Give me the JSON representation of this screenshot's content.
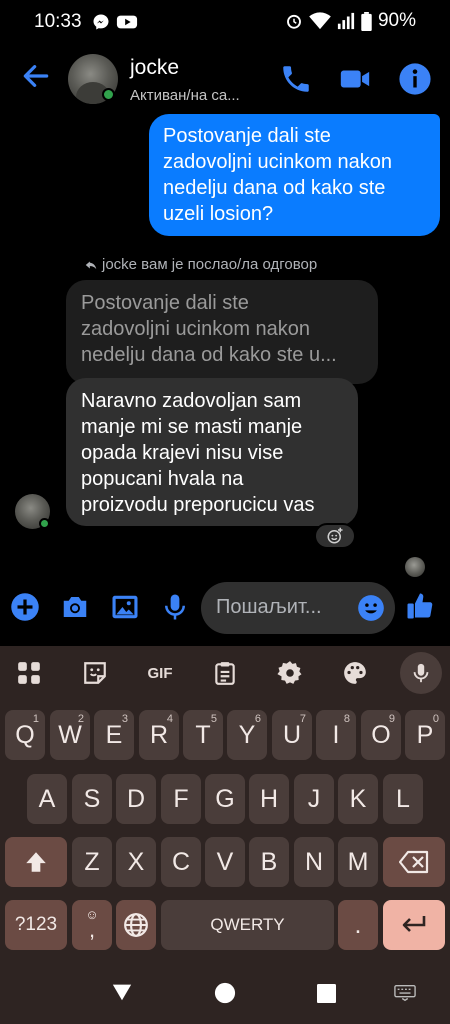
{
  "status_bar": {
    "time": "10:33",
    "battery": "90%",
    "app_icons": [
      "messenger-icon",
      "youtube-icon"
    ],
    "right_icons": [
      "alarm-icon",
      "wifi-icon",
      "signal-icon",
      "battery-icon"
    ]
  },
  "header": {
    "name": "jocke",
    "status": "Активан/на са...",
    "actions": [
      "phone-icon",
      "video-icon",
      "info-icon"
    ]
  },
  "messages": {
    "outgoing": {
      "lines": [
        "Postovanje dali ste",
        "zadovoljni ucinkom nakon",
        "nedelju dana od kako ste",
        "uzeli losion?"
      ]
    },
    "reply_note": "jocke вам је послао/ла одговор",
    "quoted": {
      "lines": [
        "Postovanje dali ste",
        "zadovoljni ucinkom nakon",
        "nedelju dana od kako ste u..."
      ]
    },
    "incoming": {
      "lines": [
        "Naravno zadovoljan sam",
        "manje mi se masti manje",
        "opada krajevi nisu vise",
        "popucani hvala na",
        "proizvodu preporucicu vas"
      ]
    }
  },
  "composer": {
    "placeholder": "Пошаљит...",
    "icons": [
      "plus-icon",
      "camera-icon",
      "gallery-icon",
      "microphone-icon",
      "emoji-icon",
      "like-icon"
    ]
  },
  "keyboard": {
    "toolbar": [
      "apps-icon",
      "sticker-icon",
      "GIF",
      "clipboard-icon",
      "settings-icon",
      "palette-icon",
      "keyboard-mic-icon"
    ],
    "gif_label": "GIF",
    "row1": [
      {
        "k": "Q",
        "n": "1"
      },
      {
        "k": "W",
        "n": "2"
      },
      {
        "k": "E",
        "n": "3"
      },
      {
        "k": "R",
        "n": "4"
      },
      {
        "k": "T",
        "n": "5"
      },
      {
        "k": "Y",
        "n": "6"
      },
      {
        "k": "U",
        "n": "7"
      },
      {
        "k": "I",
        "n": "8"
      },
      {
        "k": "O",
        "n": "9"
      },
      {
        "k": "P",
        "n": "0"
      }
    ],
    "row2": [
      "A",
      "S",
      "D",
      "F",
      "G",
      "H",
      "J",
      "K",
      "L"
    ],
    "row3": [
      "Z",
      "X",
      "C",
      "V",
      "B",
      "N",
      "M"
    ],
    "symbols": "?123",
    "comma": ",",
    "space": "QWERTY",
    "period": "."
  },
  "nav": [
    "back-icon",
    "home-icon",
    "recents-icon",
    "keyboard-switch-icon"
  ],
  "colors": {
    "accent": "#0a7cff",
    "incoming_bubble": "#303030",
    "keyboard_bg": "#2e2422",
    "enter_key": "#f0b3a5"
  }
}
